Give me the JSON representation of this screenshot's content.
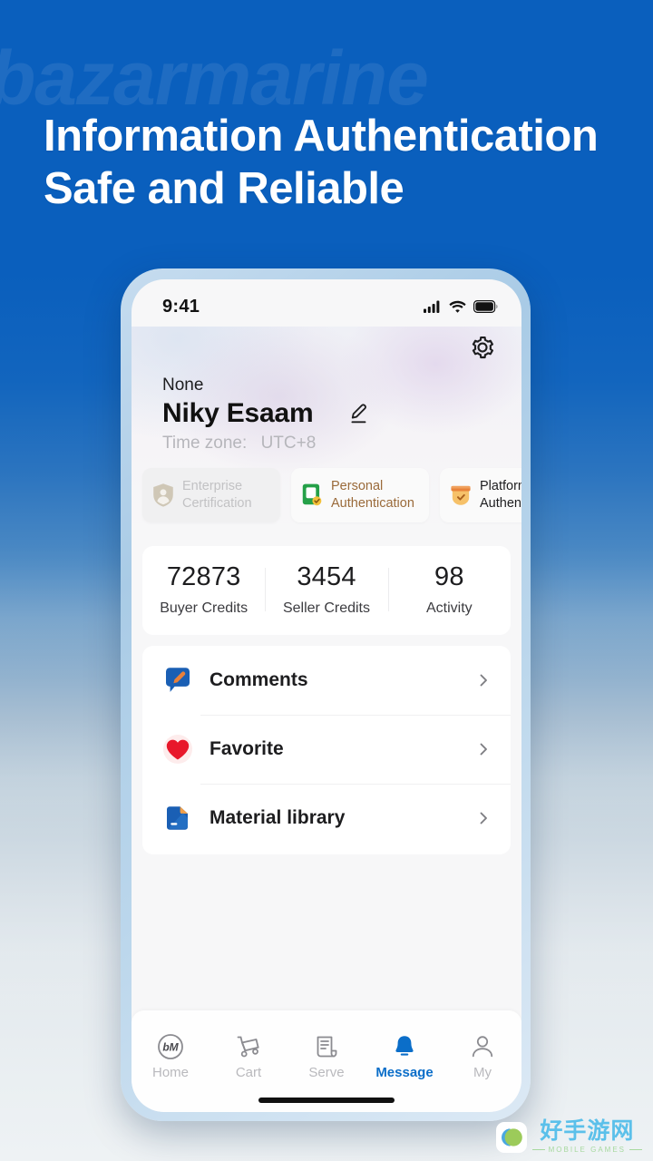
{
  "promo": {
    "watermark_wordmark": "bazarmarine",
    "headline_line1": "Information Authentication",
    "headline_line2": "Safe and Reliable",
    "background_top_color": "#0a5fbd",
    "background_bottom_color": "#eef2f4"
  },
  "phone": {
    "status_bar": {
      "time": "9:41",
      "signal_icon": "cellular-signal-icon",
      "wifi_icon": "wifi-icon",
      "battery_icon": "battery-full-icon"
    },
    "header": {
      "settings_icon": "gear-icon",
      "company_label": "None",
      "user_name": "Niky Esaam",
      "edit_icon": "pencil-edit-icon",
      "timezone_label": "Time zone:",
      "timezone_value": "UTC+8"
    },
    "badges": [
      {
        "label_line1": "Enterprise",
        "label_line2": "Certification",
        "icon": "enterprise-shield-icon",
        "state": "inactive"
      },
      {
        "label_line1": "Personal",
        "label_line2": "Authentication",
        "icon": "id-card-verified-icon",
        "state": "active"
      },
      {
        "label_line1": "Platform",
        "label_line2": "Authentication",
        "icon": "platform-badge-check-icon",
        "state": "active"
      }
    ],
    "stats": [
      {
        "value": "72873",
        "label": "Buyer Credits"
      },
      {
        "value": "3454",
        "label": "Seller Credits"
      },
      {
        "value": "98",
        "label": "Activity"
      }
    ],
    "menu": [
      {
        "label": "Comments",
        "icon": "comment-bubble-icon",
        "chevron": "chevron-right-icon"
      },
      {
        "label": "Favorite",
        "icon": "heart-icon",
        "chevron": "chevron-right-icon"
      },
      {
        "label": "Material library",
        "icon": "material-folder-icon",
        "chevron": "chevron-right-icon"
      }
    ],
    "tabs": [
      {
        "label": "Home",
        "icon": "bm-logo-icon",
        "active": false
      },
      {
        "label": "Cart",
        "icon": "shopping-cart-icon",
        "active": false
      },
      {
        "label": "Serve",
        "icon": "document-list-icon",
        "active": false
      },
      {
        "label": "Message",
        "icon": "bell-icon",
        "active": true
      },
      {
        "label": "My",
        "icon": "person-icon",
        "active": false
      }
    ],
    "active_tab_color": "#0b6ec9"
  },
  "site_watermark": {
    "name_cn": "好手游网",
    "name_en": "MOBILE GAMES",
    "logo_icon": "circle-split-logo-icon"
  }
}
